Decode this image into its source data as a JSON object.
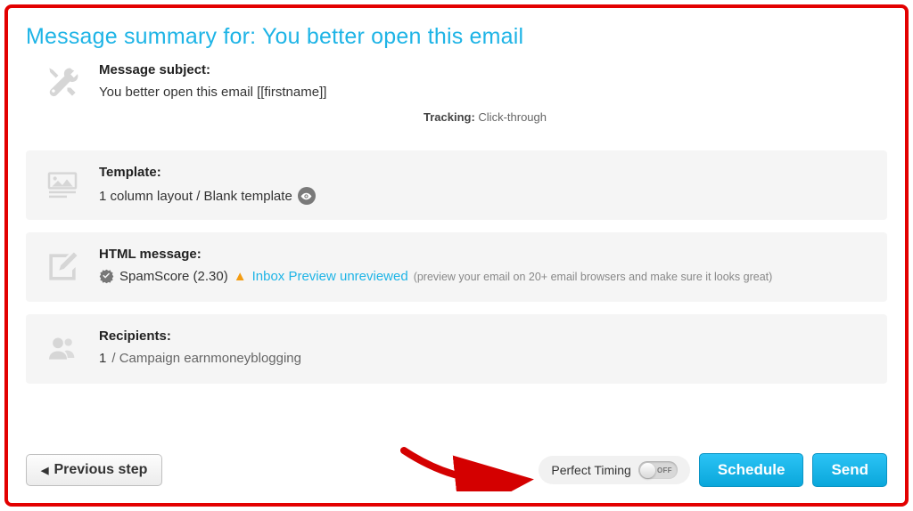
{
  "header": {
    "title_prefix": "Message summary for: ",
    "title_subject": "You better open this email"
  },
  "subject": {
    "label": "Message subject:",
    "value": "You better open this email [[firstname]]",
    "tracking_label": "Tracking:",
    "tracking_value": "Click-through"
  },
  "template": {
    "label": "Template:",
    "value": "1 column layout / Blank template"
  },
  "html": {
    "label": "HTML message:",
    "spam_score": "SpamScore (2.30)",
    "inbox_preview": "Inbox Preview unreviewed",
    "hint": "(preview your email on 20+ email browsers and make sure it looks great)"
  },
  "recipients": {
    "label": "Recipients:",
    "count": "1",
    "separator": "/ ",
    "campaign": "Campaign earnmoneyblogging"
  },
  "footer": {
    "previous": "Previous step",
    "perfect_timing": "Perfect Timing",
    "toggle_state": "OFF",
    "schedule": "Schedule",
    "send": "Send"
  }
}
